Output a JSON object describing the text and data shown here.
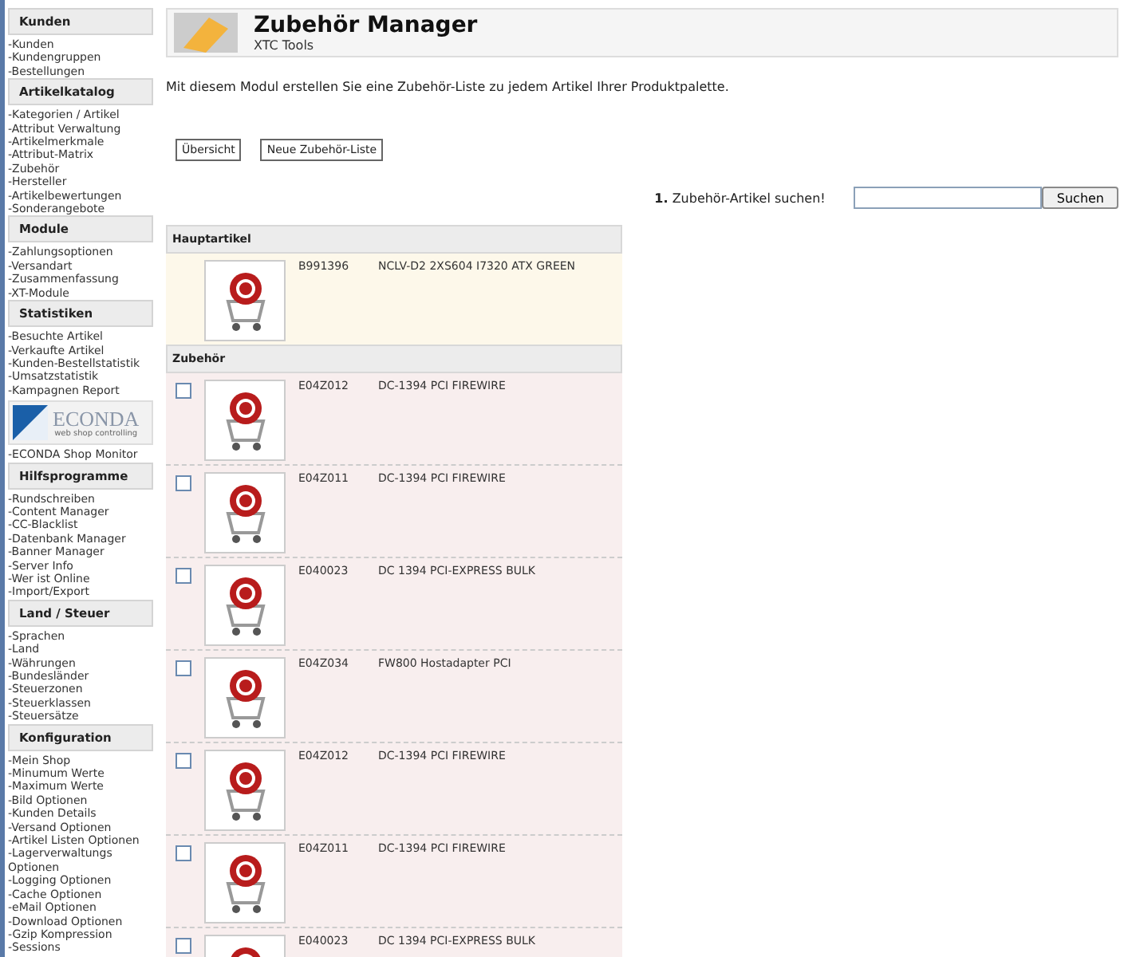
{
  "sidebar": {
    "sections": [
      {
        "title": "Kunden",
        "items": [
          "-Kunden",
          "-Kundengruppen",
          "-Bestellungen"
        ]
      },
      {
        "title": "Artikelkatalog",
        "items": [
          "-Kategorien / Artikel",
          "-Attribut Verwaltung",
          "-Artikelmerkmale",
          "-Attribut-Matrix",
          "-Zubehör",
          "-Hersteller",
          "-Artikelbewertungen",
          "-Sonderangebote"
        ]
      },
      {
        "title": "Module",
        "items": [
          "-Zahlungsoptionen",
          "-Versandart",
          "-Zusammenfassung",
          "-XT-Module"
        ]
      },
      {
        "title": "Statistiken",
        "items": [
          "-Besuchte Artikel",
          "-Verkaufte Artikel",
          "-Kunden-Bestellstatistik",
          "-Umsatzstatistik",
          "-Kampagnen Report"
        ],
        "logo": {
          "name": "ECONDA",
          "tagline": "web shop controlling"
        },
        "after_logo": [
          "-ECONDA Shop Monitor"
        ]
      },
      {
        "title": "Hilfsprogramme",
        "items": [
          "-Rundschreiben",
          "-Content Manager",
          "-CC-Blacklist",
          "-Datenbank Manager",
          "-Banner Manager",
          "-Server Info",
          "-Wer ist Online",
          "-Import/Export"
        ]
      },
      {
        "title": "Land / Steuer",
        "items": [
          "-Sprachen",
          "-Land",
          "-Währungen",
          "-Bundesländer",
          "-Steuerzonen",
          "-Steuerklassen",
          "-Steuersätze"
        ]
      },
      {
        "title": "Konfiguration",
        "items": [
          "-Mein Shop",
          "-Minumum Werte",
          "-Maximum Werte",
          "-Bild Optionen",
          "-Kunden Details",
          "-Versand Optionen",
          "-Artikel Listen Optionen",
          "-Lagerverwaltungs Optionen",
          "-Logging Optionen",
          "-Cache Optionen",
          "-eMail Optionen",
          "-Download Optionen",
          "-Gzip Kompression",
          "-Sessions"
        ]
      }
    ]
  },
  "header": {
    "title": "Zubehör Manager",
    "subtitle": "XTC Tools"
  },
  "description": "Mit diesem Modul erstellen Sie eine Zubehör-Liste zu jedem Artikel Ihrer Produktpalette.",
  "buttons": [
    "Übersicht",
    "Neue Zubehör-Liste"
  ],
  "search": {
    "step": "1.",
    "label": "Zubehör-Artikel suchen!",
    "button": "Suchen"
  },
  "main_section": {
    "title": "Hauptartikel",
    "code": "B991396",
    "name": "NCLV-D2 2XS604 I7320 ATX GREEN"
  },
  "accessories": {
    "title": "Zubehör",
    "rows": [
      {
        "checked": false,
        "code": "E04Z012",
        "name": "DC-1394 PCI FIREWIRE"
      },
      {
        "checked": false,
        "code": "E04Z011",
        "name": "DC-1394 PCI FIREWIRE"
      },
      {
        "checked": false,
        "code": "E040023",
        "name": "DC 1394 PCI-EXPRESS BULK"
      },
      {
        "checked": false,
        "code": "E04Z034",
        "name": "FW800 Hostadapter PCI"
      },
      {
        "checked": false,
        "code": "E04Z012",
        "name": "DC-1394 PCI FIREWIRE"
      },
      {
        "checked": false,
        "code": "E04Z011",
        "name": "DC-1394 PCI FIREWIRE"
      },
      {
        "checked": false,
        "code": "E040023",
        "name": "DC 1394 PCI-EXPRESS BULK"
      }
    ]
  }
}
